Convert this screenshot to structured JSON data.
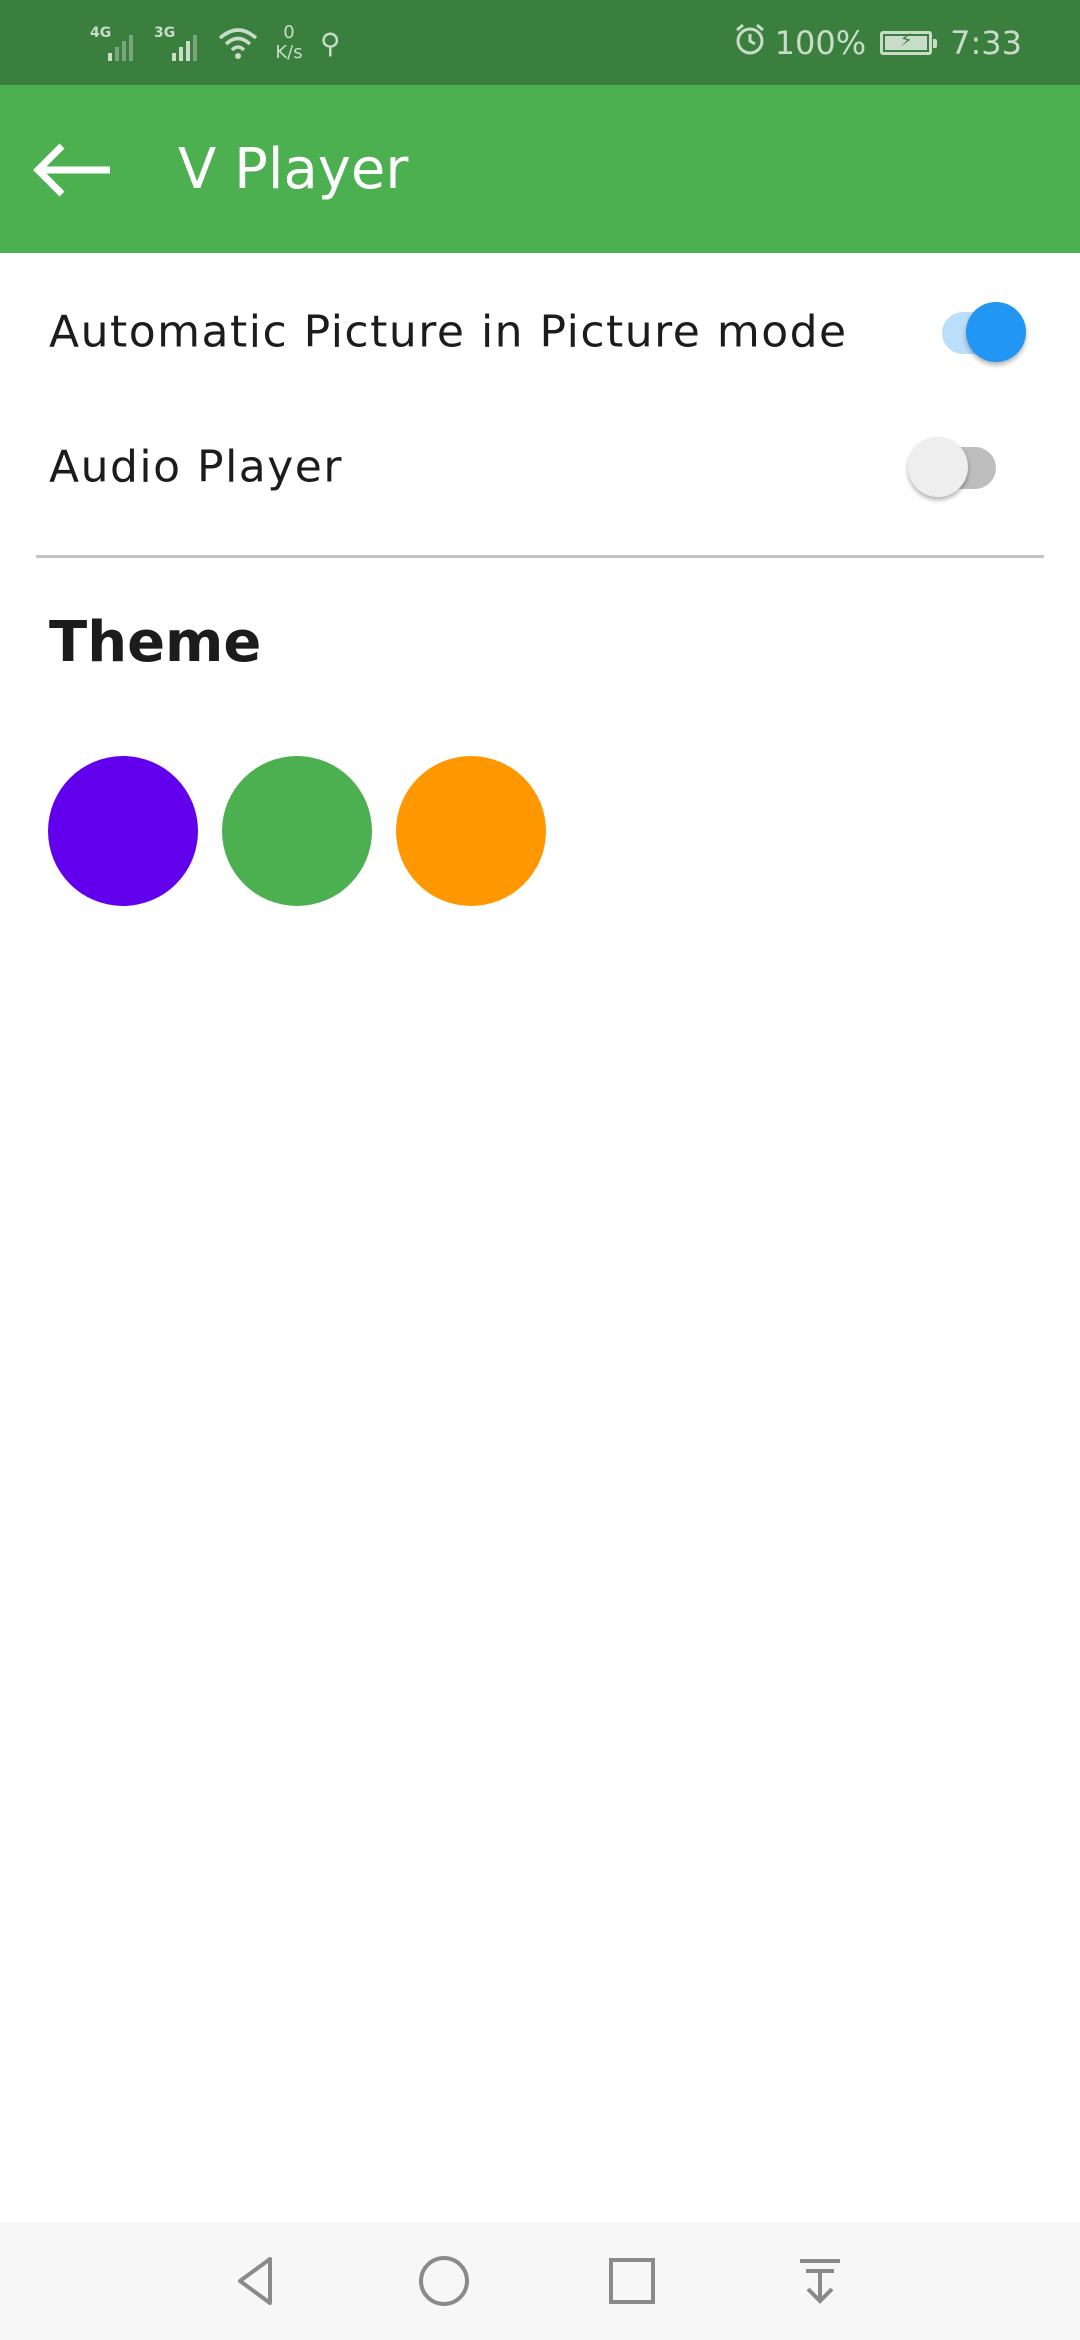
{
  "status_bar": {
    "network_1": "4G",
    "network_2": "3G",
    "speed_value": "0",
    "speed_unit": "K/s",
    "battery_percent": "100%",
    "battery_level": 1.0,
    "time": "7:33"
  },
  "app_bar": {
    "title": "V Player"
  },
  "settings": {
    "pip": {
      "label": "Automatic Picture in Picture mode",
      "enabled": true
    },
    "audio": {
      "label": "Audio Player",
      "enabled": false
    }
  },
  "theme": {
    "title": "Theme",
    "swatches": [
      "#6200ee",
      "#4caf50",
      "#ff9800"
    ]
  },
  "colors": {
    "status_bar": "#3a7f3e",
    "app_bar": "#4caf50",
    "switch_on": "#2196f3"
  }
}
